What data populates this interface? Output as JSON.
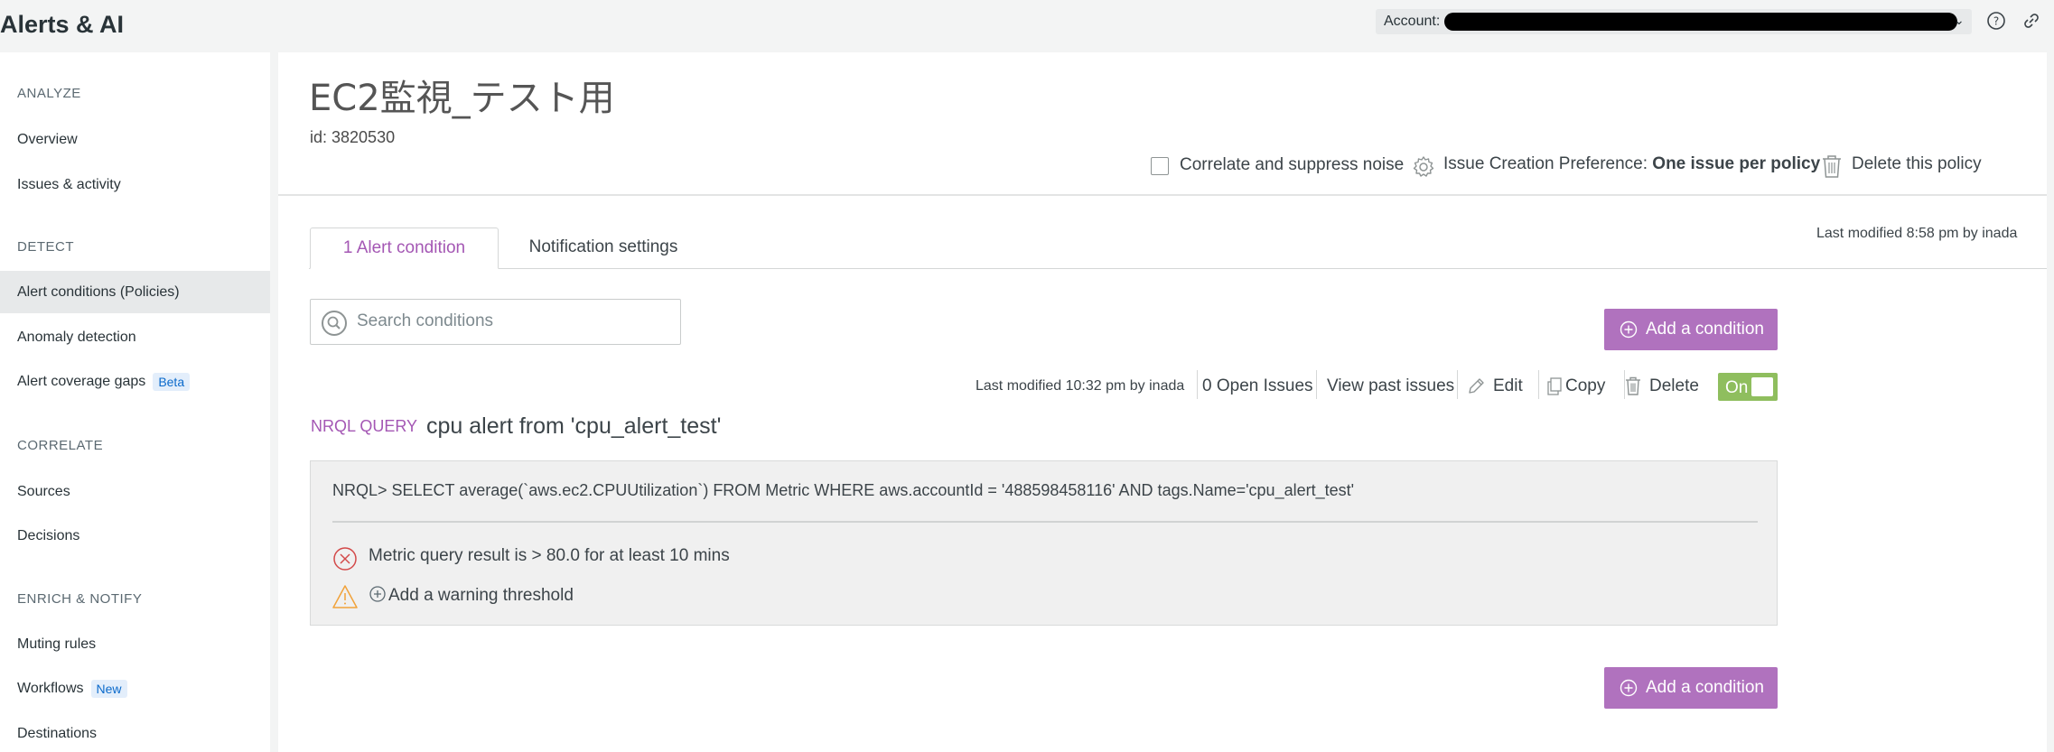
{
  "header": {
    "app_title": "Alerts & AI",
    "account_label": "Account:",
    "account_value": "",
    "help_icon": "help-circle-icon",
    "link_icon": "link-icon"
  },
  "sidebar": {
    "sections": [
      {
        "title": "ANALYZE",
        "items": [
          {
            "label": "Overview"
          },
          {
            "label": "Issues & activity"
          }
        ]
      },
      {
        "title": "DETECT",
        "items": [
          {
            "label": "Alert conditions (Policies)",
            "active": true
          },
          {
            "label": "Anomaly detection"
          },
          {
            "label": "Alert coverage gaps",
            "badge": "Beta"
          }
        ]
      },
      {
        "title": "CORRELATE",
        "items": [
          {
            "label": "Sources"
          },
          {
            "label": "Decisions"
          }
        ]
      },
      {
        "title": "ENRICH & NOTIFY",
        "items": [
          {
            "label": "Muting rules"
          },
          {
            "label": "Workflows",
            "badge": "New"
          },
          {
            "label": "Destinations"
          }
        ]
      }
    ]
  },
  "policy": {
    "title": "EC2監視_テスト用",
    "id_text": "id: 3820530",
    "correlate_label": "Correlate and suppress noise",
    "correlate_checked": false,
    "issue_pref_label": "Issue Creation Preference:",
    "issue_pref_value": "One issue per policy",
    "delete_label": "Delete this policy",
    "last_modified": "Last modified 8:58 pm by inada"
  },
  "tabs": [
    {
      "label": "1 Alert condition",
      "active": true
    },
    {
      "label": "Notification settings",
      "active": false
    }
  ],
  "search": {
    "placeholder": "Search conditions",
    "value": ""
  },
  "add_condition_label": "Add a condition",
  "condition": {
    "last_modified": "Last modified 10:32 pm by inada",
    "open_issues": "0 Open Issues",
    "view_past": "View past issues",
    "edit": "Edit",
    "copy": "Copy",
    "delete": "Delete",
    "toggle_label": "On",
    "type_label": "NRQL QUERY",
    "name": "cpu alert from 'cpu_alert_test'",
    "query": "NRQL> SELECT average(`aws.ec2.CPUUtilization`) FROM Metric WHERE aws.accountId = '488598458116' AND tags.Name='cpu_alert_test'",
    "critical_threshold": "Metric query result is > 80.0 for at least 10 mins",
    "add_warning": "Add a warning threshold"
  },
  "colors": {
    "accent": "#b072be",
    "accent_text": "#a457b4",
    "toggle_on": "#8fbe5e",
    "critical": "#d34a4a",
    "warning": "#f1a23a"
  }
}
